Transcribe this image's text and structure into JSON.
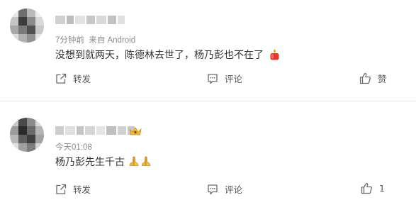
{
  "comments": [
    {
      "time": "7分钟前",
      "source": "来自 Android",
      "text": "没想到就两天，陈德林去世了，杨乃彭也不在了",
      "emojis": [
        "candle-icon"
      ],
      "actions": {
        "repost_label": "转发",
        "comment_label": "评论",
        "like_label": "赞"
      }
    },
    {
      "time": "今天01:08",
      "source": "",
      "text": "杨乃彭先生千古",
      "emojis": [
        "praying-hands-icon",
        "praying-hands-icon"
      ],
      "badge": "crown-badge-icon",
      "actions": {
        "repost_label": "转发",
        "comment_label": "评论",
        "like_count": "1"
      }
    }
  ],
  "colors": {
    "text": "#333333",
    "meta": "#8a8a8a",
    "action": "#555555",
    "divider": "#e6e6e6",
    "candle": "#e23a2e",
    "praying_hands": "#f2b53a"
  }
}
